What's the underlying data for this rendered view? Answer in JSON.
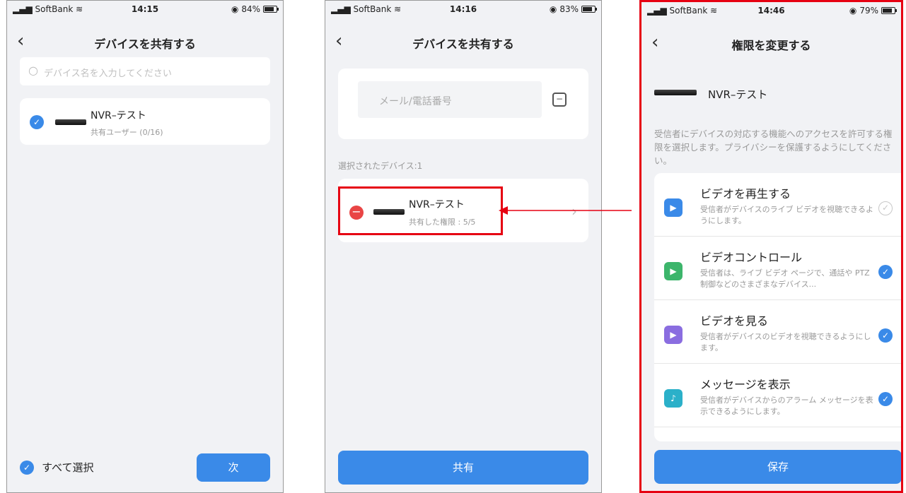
{
  "screen1": {
    "status": {
      "carrier": "SoftBank",
      "time": "14:15",
      "battery": "84%"
    },
    "title": "デバイスを共有する",
    "search_placeholder": "デバイス名を入力してください",
    "device": {
      "name": "NVR–テスト",
      "sub": "共有ユーザー (0/16)"
    },
    "select_all": "すべて選択",
    "next_button": "次"
  },
  "screen2": {
    "status": {
      "carrier": "SoftBank",
      "time": "14:16",
      "battery": "83%"
    },
    "title": "デバイスを共有する",
    "input_placeholder": "メール/電話番号",
    "selected_label": "選択されたデバイス:1",
    "device": {
      "name": "NVR–テスト",
      "sub": "共有した権限 : 5/5"
    },
    "share_button": "共有"
  },
  "screen3": {
    "status": {
      "carrier": "SoftBank",
      "time": "14:46",
      "battery": "79%"
    },
    "title": "権限を変更する",
    "device_name": "NVR–テスト",
    "description": "受信者にデバイスの対応する機能へのアクセスを許可する権限を選択します。プライバシーを保護するようにしてください。",
    "permissions": [
      {
        "title": "ビデオを再生する",
        "desc": "受信者がデバイスのライブ ビデオを視聴できるようにします。",
        "color": "#3a8ae8"
      },
      {
        "title": "ビデオコントロール",
        "desc": "受信者は、ライブ ビデオ ページで、通話や PTZ 制御などのさまざまなデバイス...",
        "color": "#3cb56b"
      },
      {
        "title": "ビデオを見る",
        "desc": "受信者がデバイスのビデオを視聴できるようにします。",
        "color": "#8a6de0"
      },
      {
        "title": "メッセージを表示",
        "desc": "受信者がデバイスからのアラーム メッセージを表示できるようにします。",
        "color": "#2bb0c9"
      }
    ],
    "save_button": "保存"
  },
  "colors": {
    "accent": "#3a8ae8",
    "highlight": "#e60012"
  }
}
